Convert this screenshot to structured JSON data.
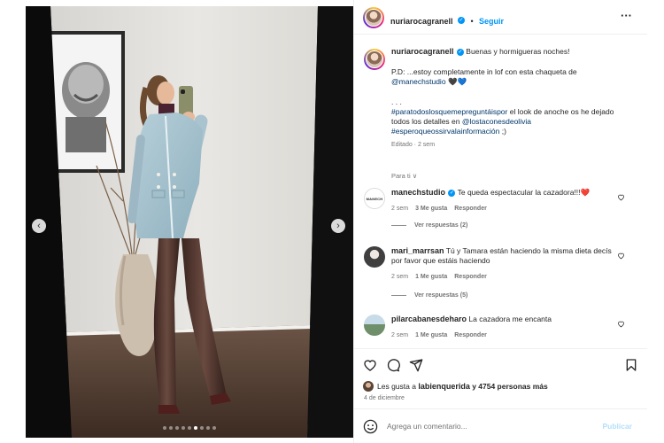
{
  "post": {
    "author": "nuriarocagranell",
    "follow_label": "Seguir",
    "bullet": "•",
    "more": "···"
  },
  "caption": {
    "user": "nuriarocagranell",
    "line1": "Buenas y hormigueras noches!",
    "line2_prefix": "P.D: ...estoy completamente in lof con esta chaqueta de",
    "mention1": "@manechstudio",
    "emoji": "🖤💙",
    "dots": ". . .",
    "hashtag1": "#paratodoslosquemepreguntáispor",
    "line4_suffix": " el look de anoche os he dejado",
    "line5_prefix": "todos los detalles en ",
    "mention2": "@lostaconesdeolivia",
    "hashtag2": "#esperoqueossirvalainformación",
    "line6_suffix": " ;)",
    "meta": "Editado · 2 sem"
  },
  "for_you": "Para ti ∨",
  "comments": [
    {
      "user": "manechstudio",
      "verified": true,
      "text": "Te queda espectacular la cazadora!!!",
      "emoji": "❤️",
      "time": "2 sem",
      "likes": "3 Me gusta",
      "reply": "Responder",
      "avatar_text": "MANECH",
      "replies": "Ver respuestas (2)"
    },
    {
      "user": "mari_marrsan",
      "verified": false,
      "text": "Tú y Tamara están haciendo la misma dieta decís por favor que estáis haciendo",
      "time": "2 sem",
      "likes": "1 Me gusta",
      "reply": "Responder",
      "replies": "Ver respuestas (5)"
    },
    {
      "user": "pilarcabanesdeharo",
      "verified": false,
      "text": "La cazadora me encanta",
      "time": "2 sem",
      "likes": "1 Me gusta",
      "reply": "Responder"
    }
  ],
  "likes": {
    "prefix": "Les gusta a ",
    "user": "labienquerida",
    "suffix": " y 4754 personas más"
  },
  "date": "4 de diciembre",
  "composer": {
    "placeholder": "Agrega un comentario...",
    "publish": "Publicar"
  },
  "carousel": {
    "slides": 9,
    "active_index": 5
  }
}
